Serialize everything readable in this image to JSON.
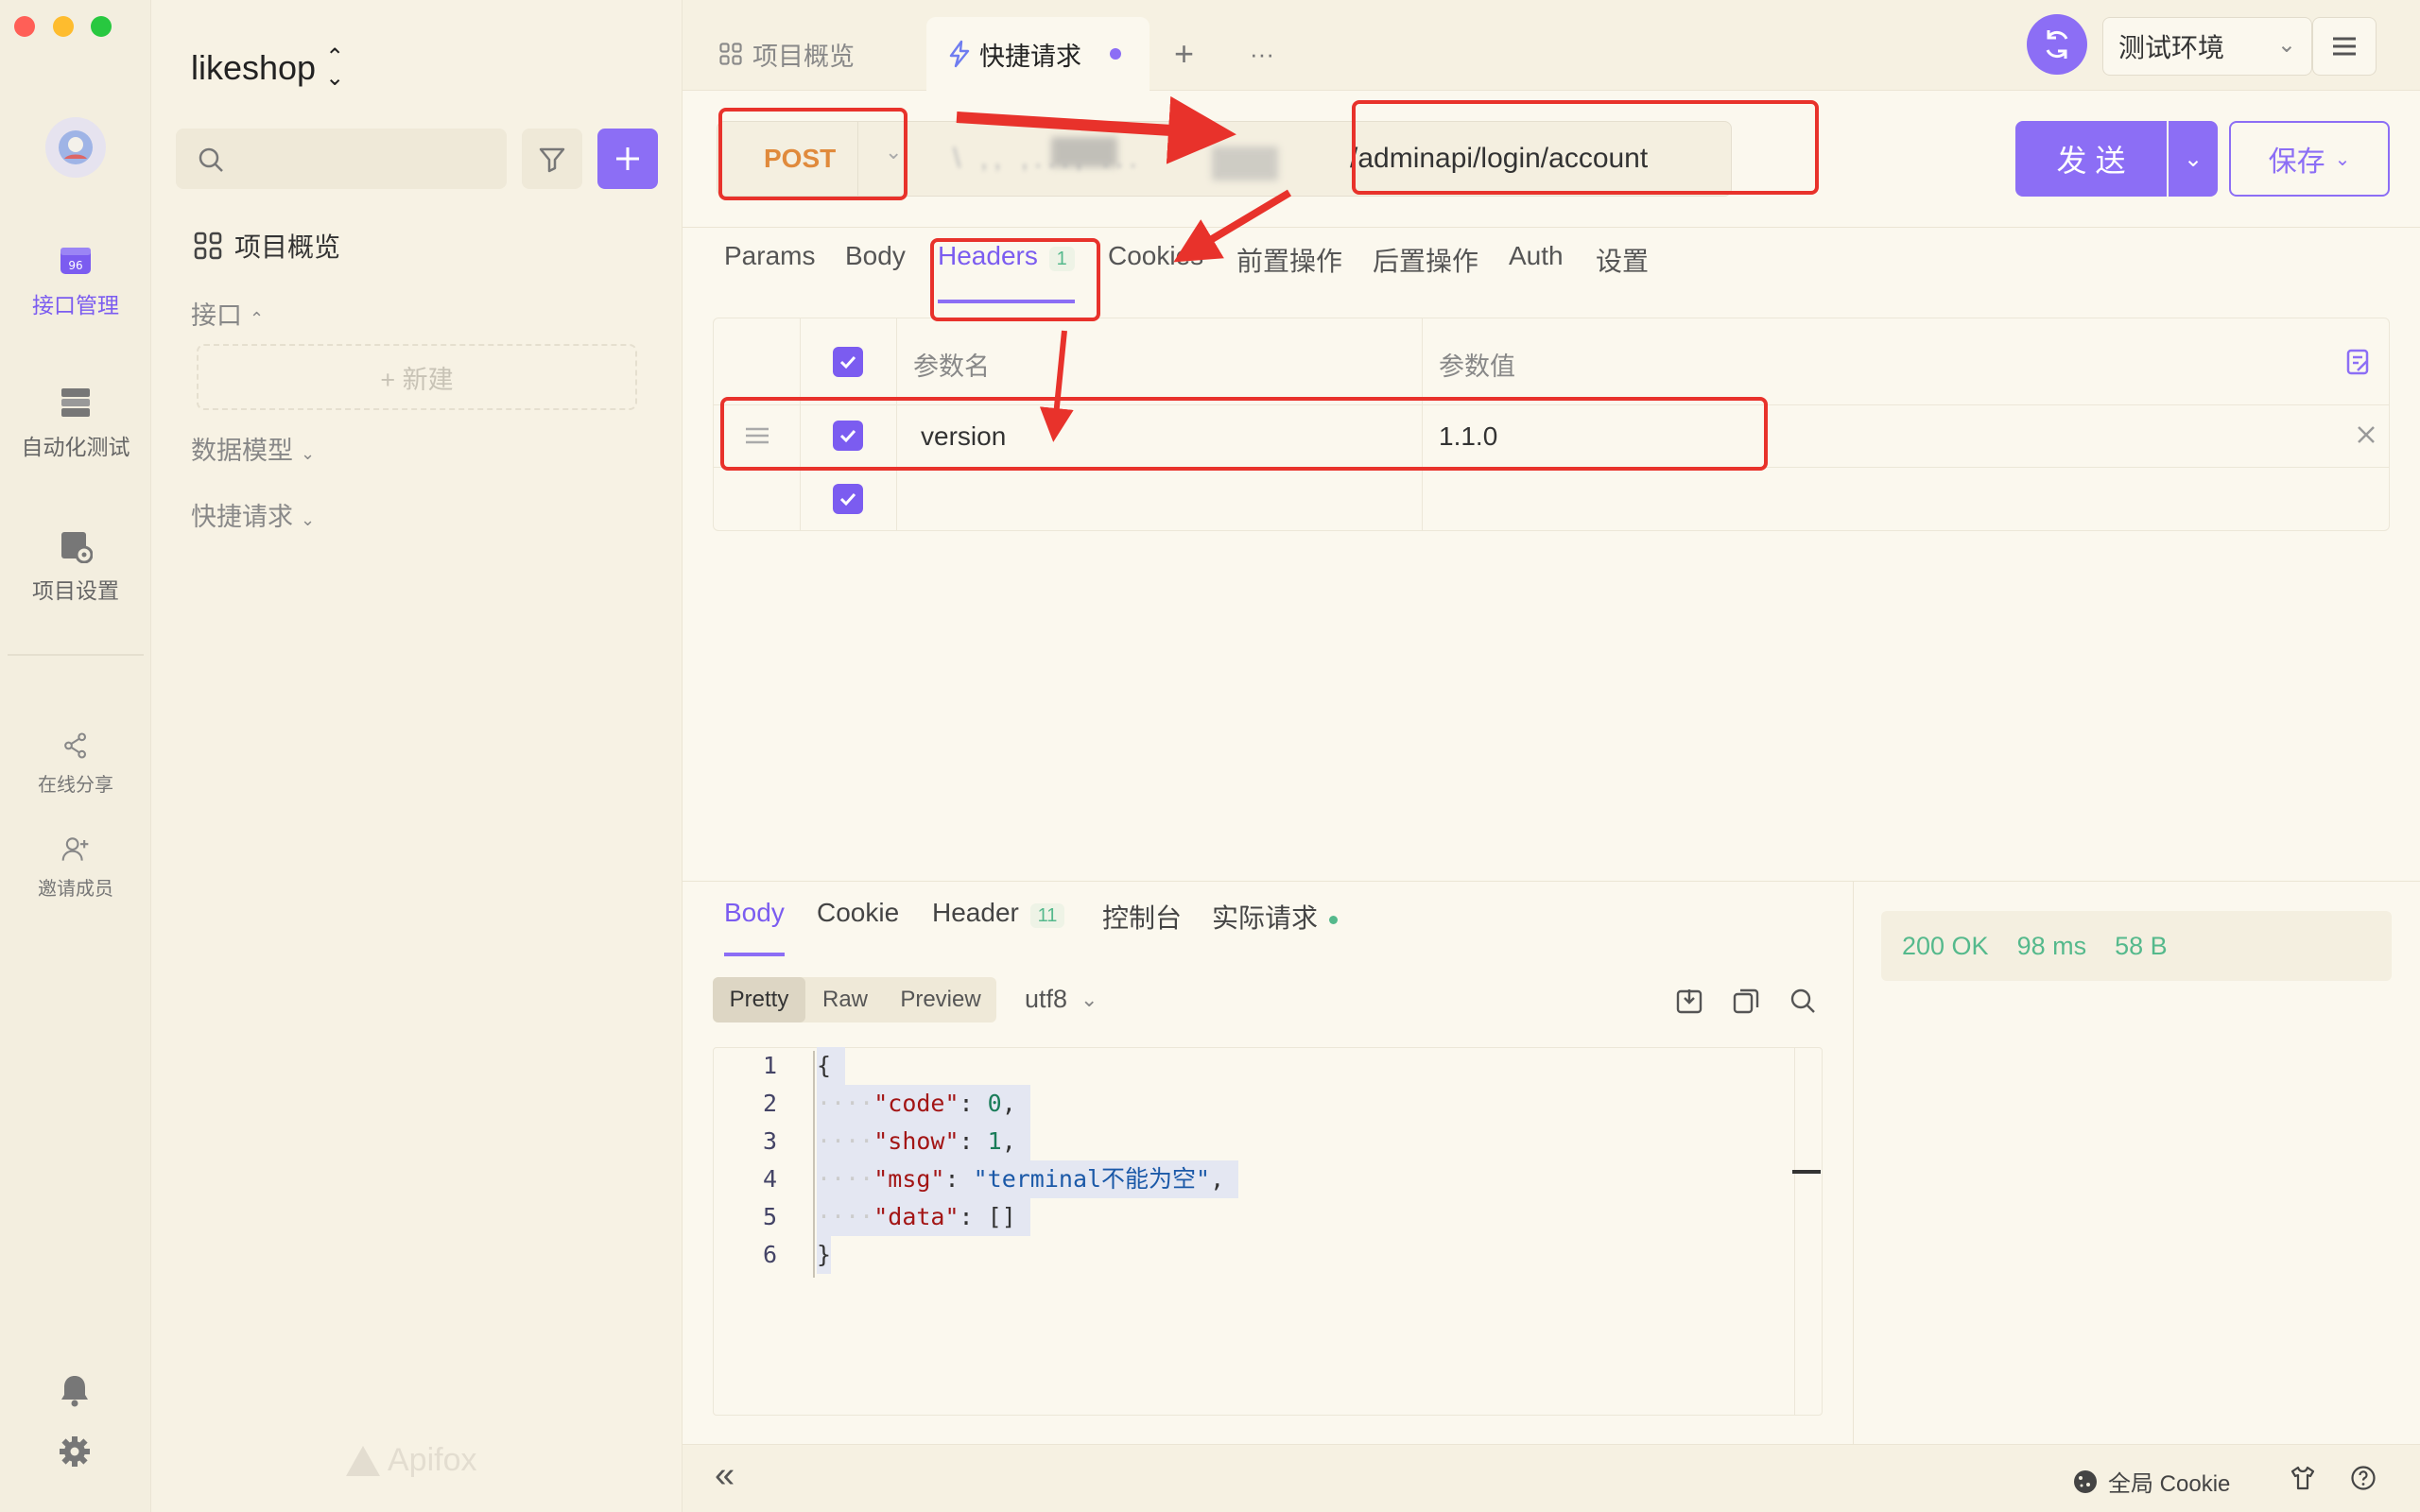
{
  "window": {
    "traffic_lights": [
      "#ff5f57",
      "#febc2e",
      "#28c840"
    ]
  },
  "rail": {
    "items": [
      {
        "label": "接口管理",
        "icon": "api-icon",
        "active": true
      },
      {
        "label": "自动化测试",
        "icon": "automation-icon",
        "active": false
      },
      {
        "label": "项目设置",
        "icon": "project-settings-icon",
        "active": false
      },
      {
        "label": "在线分享",
        "icon": "share-icon",
        "active": false
      },
      {
        "label": "邀请成员",
        "icon": "invite-icon",
        "active": false
      }
    ]
  },
  "sidebar": {
    "project_name": "likeshop",
    "search_placeholder": "",
    "overview": "项目概览",
    "groups": {
      "interface": "接口",
      "new_button": "+ 新建",
      "data_model": "数据模型",
      "quick_request": "快捷请求"
    },
    "watermark": "Apifox"
  },
  "top_tabs": {
    "overview": "项目概览",
    "quick_request": "快捷请求",
    "add": "+",
    "more": "···"
  },
  "env": {
    "selected": "测试环境"
  },
  "request": {
    "method": "POST",
    "url_visible": "/adminapi/login/account",
    "url_prefix_blurred": "\\ ,, ,..., ...",
    "send": "发 送",
    "save": "保存"
  },
  "request_tabs": {
    "params": "Params",
    "body": "Body",
    "headers": "Headers",
    "headers_count": "1",
    "cookies": "Cookies",
    "pre": "前置操作",
    "post": "后置操作",
    "auth": "Auth",
    "settings": "设置"
  },
  "headers_table": {
    "col_name": "参数名",
    "col_value": "参数值",
    "rows": [
      {
        "name": "version",
        "value": "1.1.0",
        "checked": true
      },
      {
        "name": "",
        "value": "",
        "checked": true
      }
    ]
  },
  "response": {
    "tabs": {
      "body": "Body",
      "cookie": "Cookie",
      "header": "Header",
      "header_count": "11",
      "console": "控制台",
      "actual": "实际请求"
    },
    "format_tabs": [
      "Pretty",
      "Raw",
      "Preview"
    ],
    "encoding": "utf8",
    "status": {
      "code": "200 OK",
      "time": "98 ms",
      "size": "58 B"
    },
    "line_numbers": [
      "1",
      "2",
      "3",
      "4",
      "5",
      "6"
    ],
    "json_values": {
      "code_key": "\"code\"",
      "code_val": "0",
      "show_key": "\"show\"",
      "show_val": "1",
      "msg_key": "\"msg\"",
      "msg_val": "\"terminal不能为空\"",
      "data_key": "\"data\"",
      "data_val": "[]"
    }
  },
  "footer": {
    "cookie": "全局 Cookie",
    "collapse": "«"
  },
  "colors": {
    "accent": "#7b5cf0",
    "post": "#e08a3c",
    "success": "#55b98c",
    "annotation": "#e8322b"
  }
}
